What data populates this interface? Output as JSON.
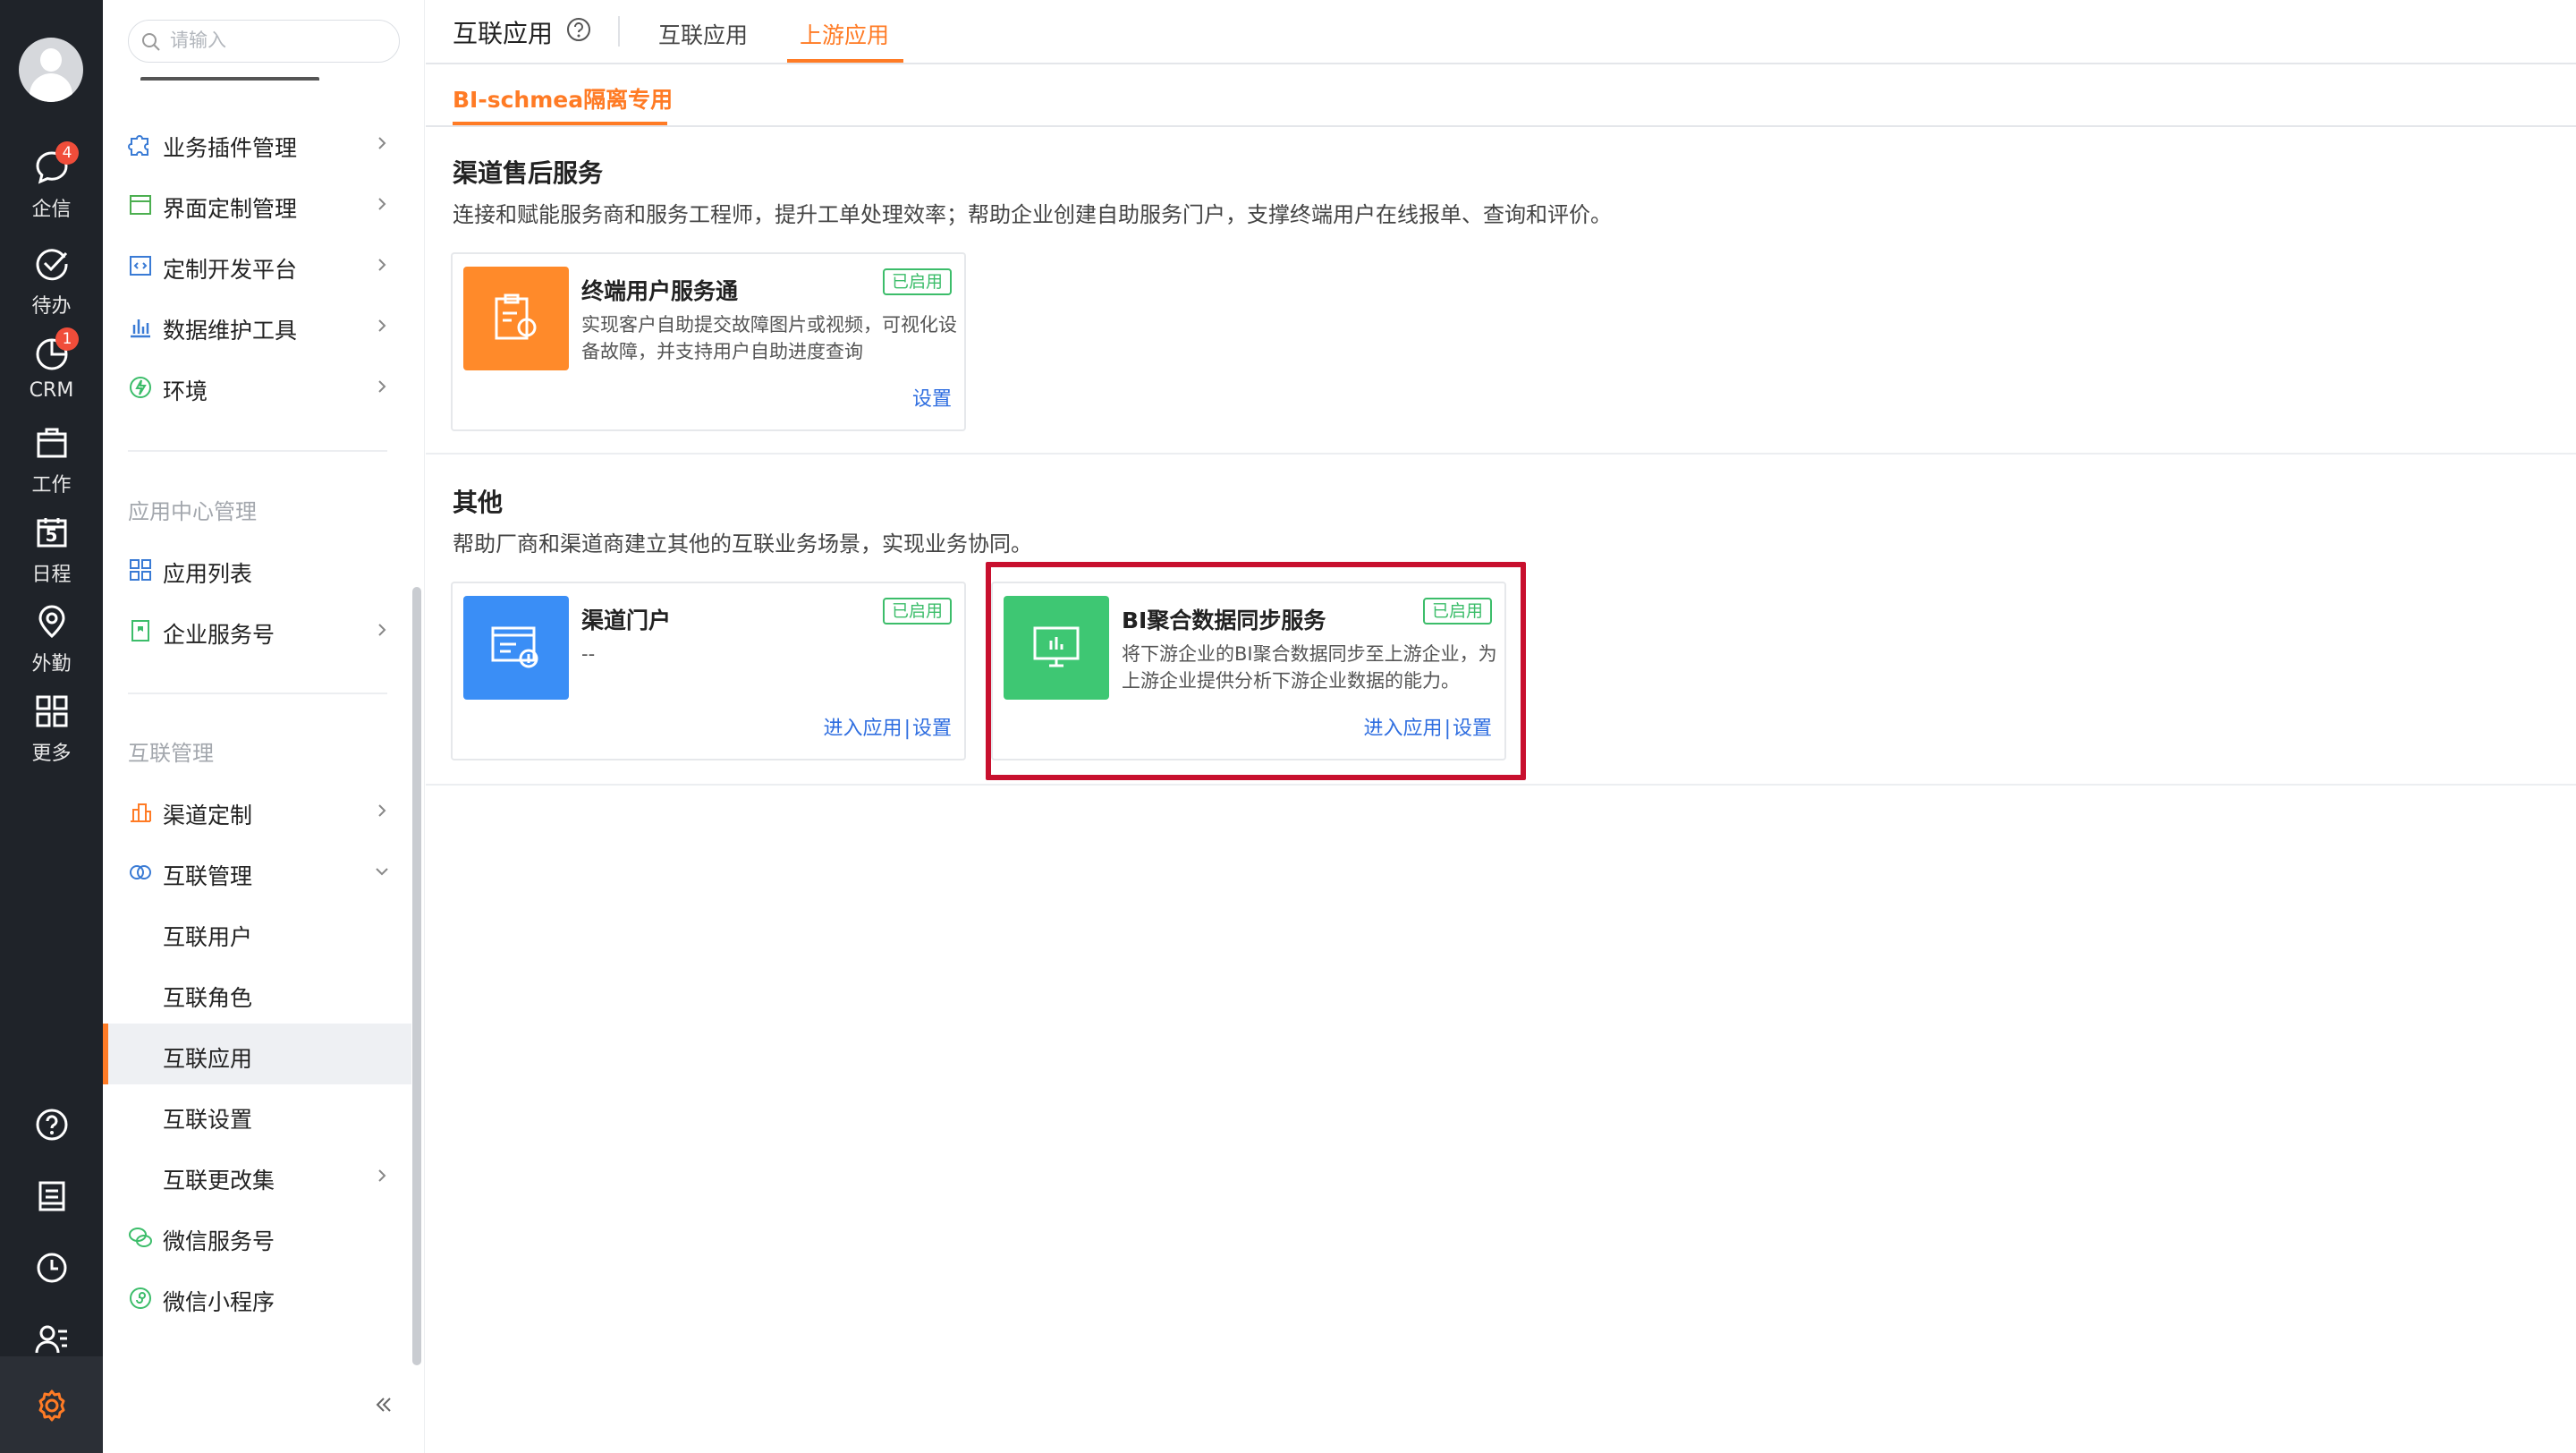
{
  "rail": {
    "items": [
      {
        "name": "qixin",
        "label": "企信",
        "badge": "4"
      },
      {
        "name": "daiban",
        "label": "待办",
        "badge": ""
      },
      {
        "name": "crm",
        "label": "CRM",
        "badge": "1"
      },
      {
        "name": "gongzuo",
        "label": "工作",
        "badge": ""
      },
      {
        "name": "richeng",
        "label": "日程",
        "badge": "",
        "day": "5"
      },
      {
        "name": "waiqin",
        "label": "外勤",
        "badge": ""
      },
      {
        "name": "gengduo",
        "label": "更多",
        "badge": ""
      }
    ],
    "icons": [
      "help-icon",
      "notepad-icon",
      "clock-icon",
      "contacts-icon",
      "gear-icon"
    ]
  },
  "sidebar": {
    "search_placeholder": "请输入",
    "items": [
      {
        "label": "业务插件管理",
        "icon": "puzzle-icon",
        "chevron": true
      },
      {
        "label": "界面定制管理",
        "icon": "layout-icon",
        "chevron": true
      },
      {
        "label": "定制开发平台",
        "icon": "code-icon",
        "chevron": true
      },
      {
        "label": "数据维护工具",
        "icon": "bar-chart-icon",
        "chevron": true
      },
      {
        "label": "环境",
        "icon": "environment-icon",
        "chevron": true
      }
    ],
    "group_app_center": "应用中心管理",
    "app_items": [
      {
        "label": "应用列表",
        "icon": "grid-icon",
        "chevron": false
      },
      {
        "label": "企业服务号",
        "icon": "bookmark-icon",
        "chevron": true
      }
    ],
    "group_interconnect": "互联管理",
    "interconnect_items": [
      {
        "label": "渠道定制",
        "icon": "channel-icon",
        "chevron": true
      },
      {
        "label": "互联管理",
        "icon": "link-icon",
        "chevron": "down"
      }
    ],
    "sub_items": [
      {
        "label": "互联用户"
      },
      {
        "label": "互联角色"
      },
      {
        "label": "互联应用",
        "active": true
      },
      {
        "label": "互联设置"
      },
      {
        "label": "互联更改集",
        "chevron": true
      }
    ],
    "wechat_items": [
      {
        "label": "微信服务号",
        "icon": "wechat-icon"
      },
      {
        "label": "微信小程序",
        "icon": "mini-program-icon"
      }
    ]
  },
  "header": {
    "title": "互联应用",
    "tabs": [
      {
        "label": "互联应用",
        "active": false
      },
      {
        "label": "上游应用",
        "active": true
      }
    ],
    "subtab": "BI-schmea隔离专用"
  },
  "sections": [
    {
      "title": "渠道售后服务",
      "desc": "连接和赋能服务商和服务工程师，提升工单处理效率；帮助企业创建自助服务门户，支撑终端用户在线报单、查询和评价。",
      "cards": [
        {
          "title": "终端用户服务通",
          "status": "已启用",
          "desc": "实现客户自助提交故障图片或视频，可视化设备故障，并支持用户自助进度查询",
          "actions": [
            "设置"
          ],
          "color": "#ff8a2a"
        }
      ]
    },
    {
      "title": "其他",
      "desc": "帮助厂商和渠道商建立其他的互联业务场景，实现业务协同。",
      "cards": [
        {
          "title": "渠道门户",
          "status": "已启用",
          "desc": "--",
          "actions": [
            "进入应用",
            "设置"
          ],
          "color": "#3a8ef6"
        },
        {
          "title": "BI聚合数据同步服务",
          "status": "已启用",
          "desc": "将下游企业的BI聚合数据同步至上游企业，为上游企业提供分析下游企业数据的能力。",
          "actions": [
            "进入应用",
            "设置"
          ],
          "color": "#3ec773"
        }
      ]
    }
  ],
  "colors": {
    "accent": "#ff7b25",
    "rail_bg": "#1f2329",
    "link": "#2f6ee0",
    "enabled": "#3cbd6a",
    "highlight": "#c8102e"
  }
}
